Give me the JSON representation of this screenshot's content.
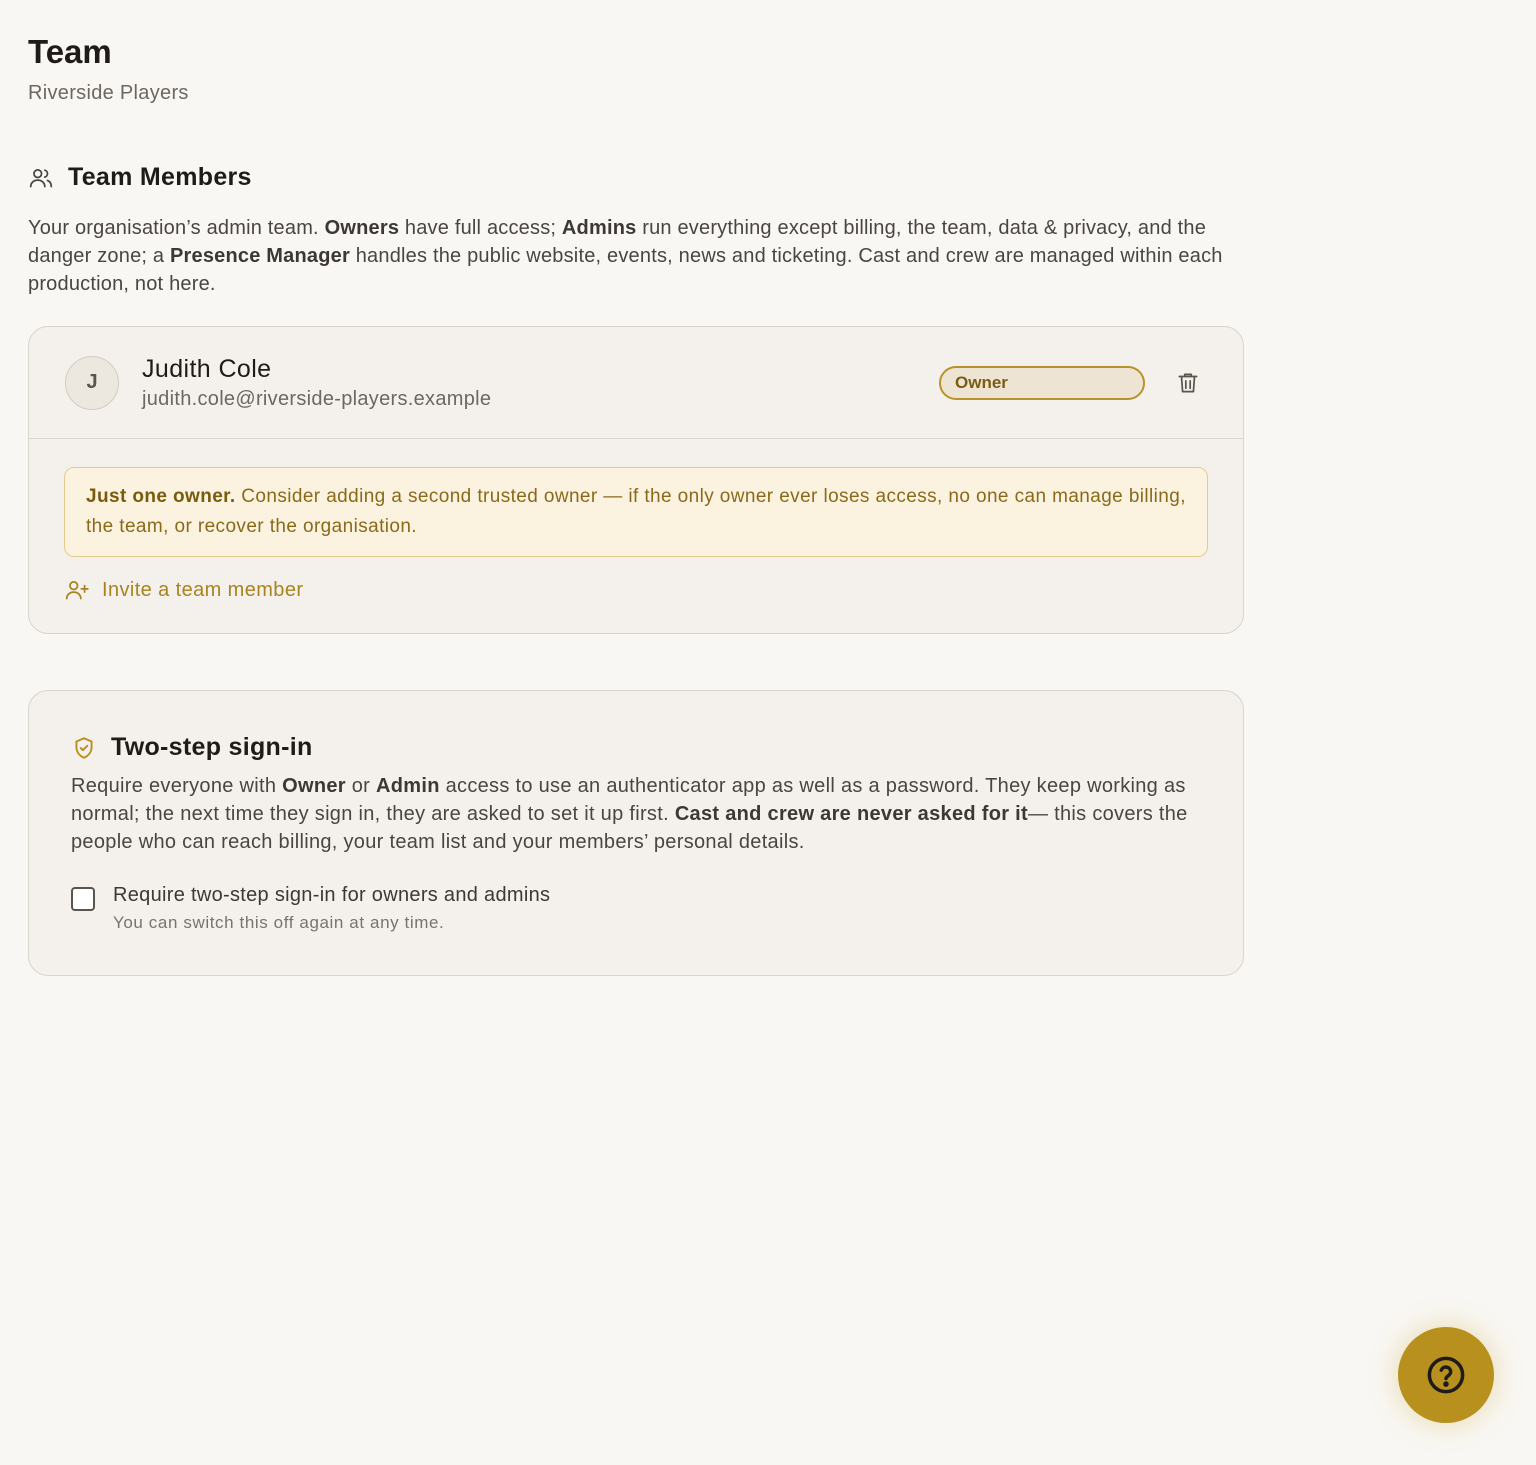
{
  "page": {
    "title": "Team",
    "subtitle": "Riverside Players"
  },
  "team_members": {
    "heading": "Team Members",
    "intro": {
      "t1": "Your organisation’s admin team. ",
      "b1": "Owners",
      "t2": " have full access; ",
      "b2": "Admins",
      "t3": " run everything except billing, the team, data & privacy, and the danger zone; a ",
      "b3": "Presence Manager",
      "t4": " handles the public website, events, news and ticketing. Cast and crew are managed within each production, not here."
    },
    "members": [
      {
        "initial": "J",
        "name": "Judith Cole",
        "email": "judith.cole@riverside-players.example",
        "role": "Owner"
      }
    ],
    "warning": {
      "bold": "Just one owner.",
      "text": " Consider adding a second trusted owner — if the only owner ever loses access, no one can manage billing, the team, or recover the organisation."
    },
    "invite_label": "Invite a team member"
  },
  "two_step": {
    "heading": "Two-step sign-in",
    "desc": {
      "t1": "Require everyone with ",
      "b1": "Owner",
      "t2": " or ",
      "b2": "Admin",
      "t3": " access to use an authenticator app as well as a password. They keep working as normal; the next time they sign in, they are asked to set it up first. ",
      "b3": "Cast and crew are never asked for it",
      "t4": "— this covers the people who can reach billing, your team list and your members’ personal details."
    },
    "checkbox_label": "Require two-step sign-in for owners and admins",
    "checkbox_checked": false,
    "checkbox_hint": "You can switch this off again at any time."
  },
  "icons": {
    "team": "users-icon",
    "trash": "trash-icon",
    "invite": "user-plus-icon",
    "shield": "shield-check-icon",
    "help": "help-circle-icon"
  },
  "colors": {
    "accent": "#b8901e",
    "background": "#f9f7f3",
    "card": "#f4f1ec",
    "warning_bg": "#fbf3df"
  }
}
